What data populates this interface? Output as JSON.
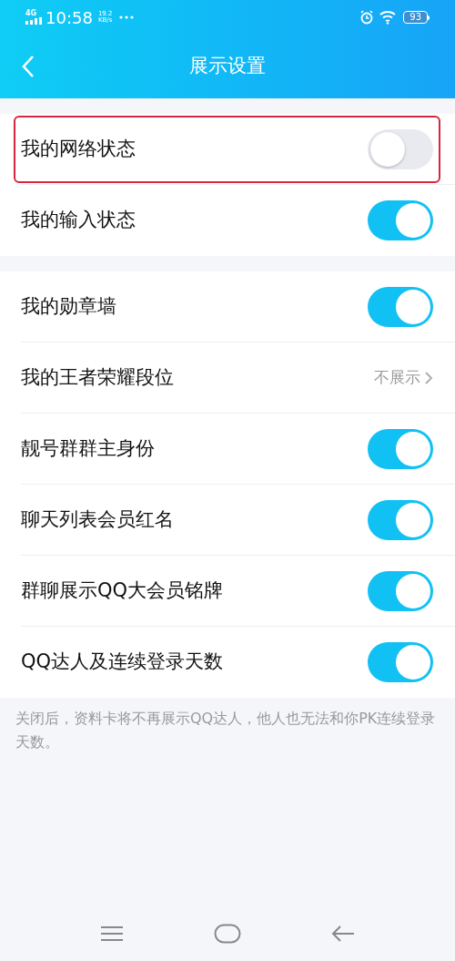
{
  "status_bar": {
    "network": "4G",
    "time": "10:58",
    "speed_value": "19.2",
    "speed_unit": "KB/s",
    "battery": "93"
  },
  "header": {
    "title": "展示设置"
  },
  "sections": [
    {
      "rows": [
        {
          "kind": "toggle",
          "label": "我的网络状态",
          "on": false,
          "highlighted": true
        },
        {
          "kind": "toggle",
          "label": "我的输入状态",
          "on": true,
          "highlighted": false
        }
      ]
    },
    {
      "rows": [
        {
          "kind": "toggle",
          "label": "我的勋章墙",
          "on": true,
          "highlighted": false
        },
        {
          "kind": "value",
          "label": "我的王者荣耀段位",
          "value": "不展示",
          "highlighted": false
        },
        {
          "kind": "toggle",
          "label": "靓号群群主身份",
          "on": true,
          "highlighted": false
        },
        {
          "kind": "toggle",
          "label": "聊天列表会员红名",
          "on": true,
          "highlighted": false
        },
        {
          "kind": "toggle",
          "label": "群聊展示QQ大会员铭牌",
          "on": true,
          "highlighted": false
        },
        {
          "kind": "toggle",
          "label": "QQ达人及连续登录天数",
          "on": true,
          "highlighted": false
        }
      ]
    }
  ],
  "footnote": "关闭后，资料卡将不再展示QQ达人，他人也无法和你PK连续登录天数。"
}
